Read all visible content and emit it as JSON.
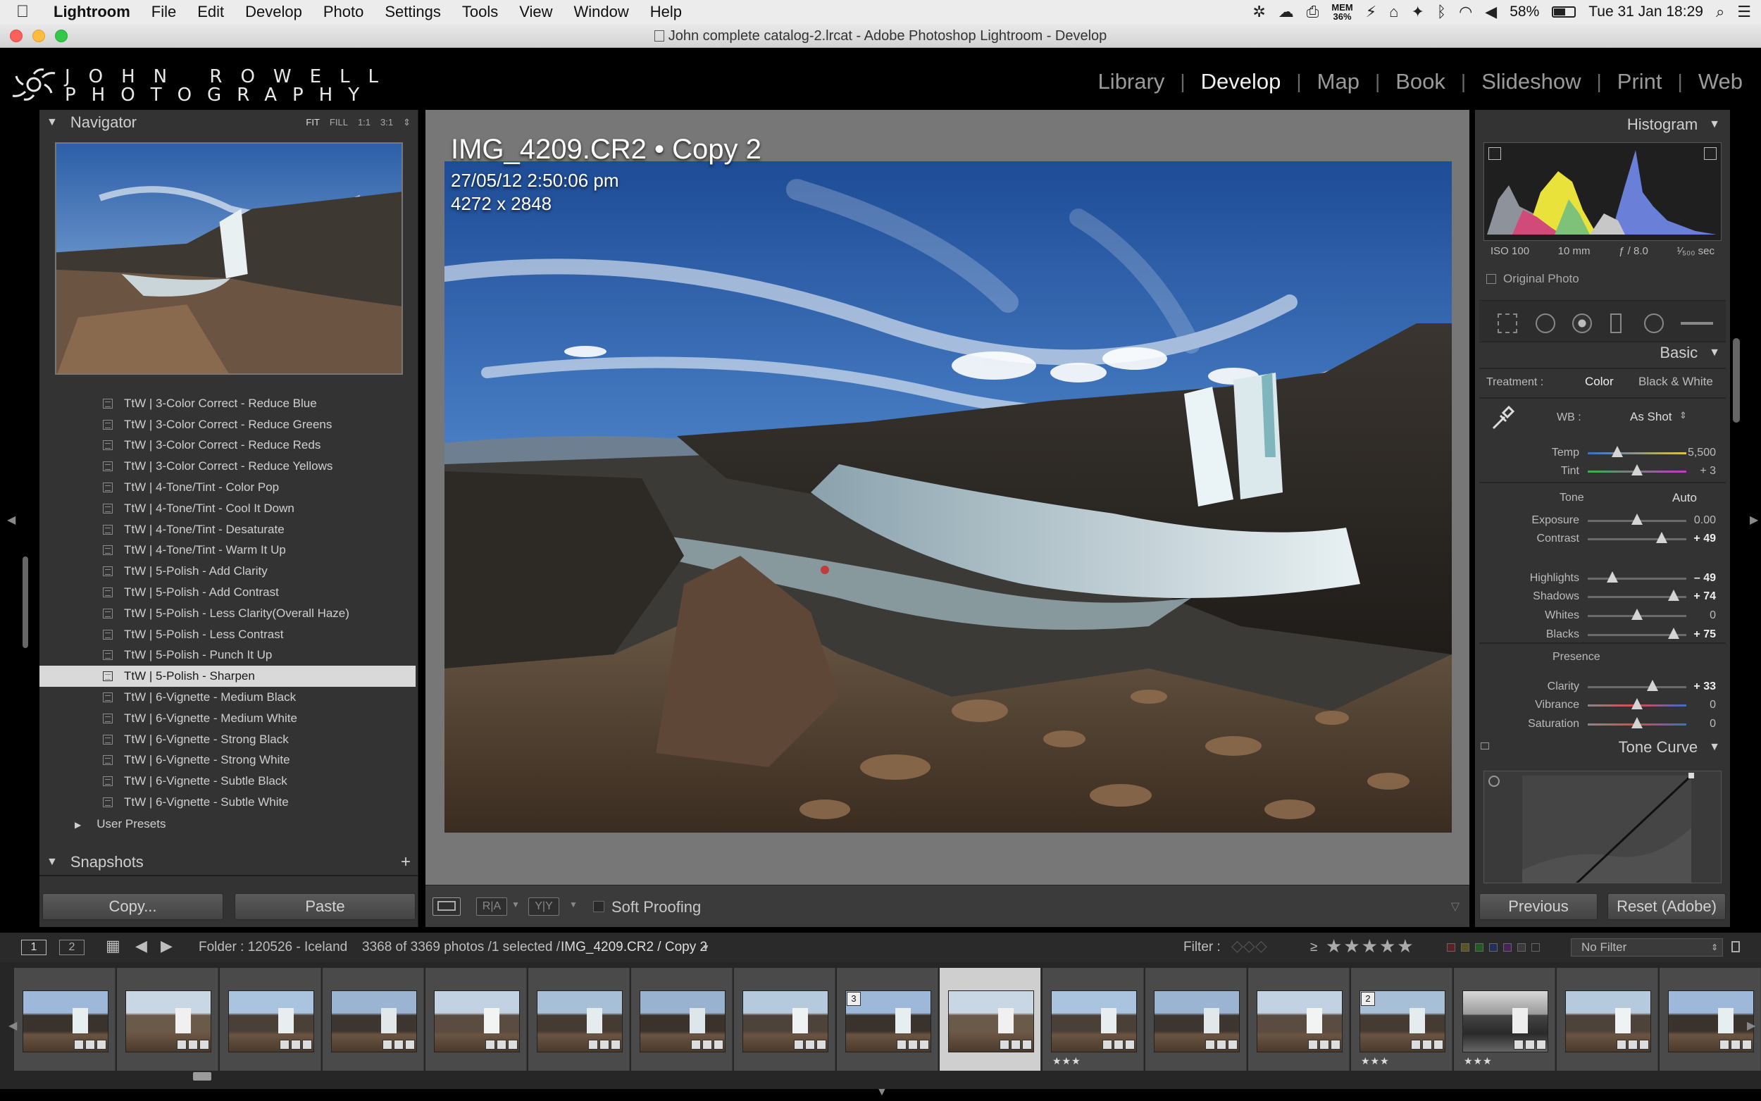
{
  "menubar": {
    "app": "Lightroom",
    "items": [
      "File",
      "Edit",
      "Develop",
      "Photo",
      "Settings",
      "Tools",
      "View",
      "Window",
      "Help"
    ],
    "memory": "MEM",
    "memory_pct": "36%",
    "battery": "58%",
    "clock": "Tue 31 Jan  18:29"
  },
  "window": {
    "title": "John complete catalog-2.lrcat - Adobe Photoshop Lightroom - Develop"
  },
  "identity": {
    "line1": "JOHN ROWELL",
    "line2": "PHOTOGRAPHY"
  },
  "modules": [
    "Library",
    "Develop",
    "Map",
    "Book",
    "Slideshow",
    "Print",
    "Web"
  ],
  "active_module": "Develop",
  "navigator": {
    "title": "Navigator",
    "opts": [
      "FIT",
      "FILL",
      "1:1",
      "3:1"
    ]
  },
  "presets": [
    "TtW | 3-Color Correct - Reduce Blue",
    "TtW | 3-Color Correct - Reduce Greens",
    "TtW | 3-Color Correct - Reduce Reds",
    "TtW | 3-Color Correct - Reduce Yellows",
    "TtW | 4-Tone/Tint - Color Pop",
    "TtW | 4-Tone/Tint - Cool It Down",
    "TtW | 4-Tone/Tint - Desaturate",
    "TtW | 4-Tone/Tint - Warm It Up",
    "TtW | 5-Polish - Add Clarity",
    "TtW | 5-Polish - Add Contrast",
    "TtW | 5-Polish - Less Clarity(Overall Haze)",
    "TtW | 5-Polish - Less Contrast",
    "TtW | 5-Polish - Punch It Up",
    "TtW | 5-Polish - Sharpen",
    "TtW | 6-Vignette - Medium Black",
    "TtW | 6-Vignette - Medium White",
    "TtW | 6-Vignette - Strong Black",
    "TtW | 6-Vignette - Strong White",
    "TtW | 6-Vignette - Subtle Black",
    "TtW | 6-Vignette - Subtle White"
  ],
  "selected_preset": "TtW | 5-Polish - Sharpen",
  "user_presets": "User Presets",
  "snapshots": {
    "title": "Snapshots",
    "add": "+"
  },
  "left_buttons": {
    "copy": "Copy...",
    "paste": "Paste"
  },
  "image_info": {
    "filename": "IMG_4209.CR2  •  Copy 2",
    "datetime": "27/05/12 2:50:06 pm",
    "dimensions": "4272 x 2848"
  },
  "toolbar": {
    "view_mode_1": "R|A",
    "view_mode_2": "Y|Y",
    "soft_proofing": "Soft Proofing"
  },
  "histogram": {
    "title": "Histogram",
    "iso": "ISO 100",
    "focal": "10 mm",
    "aperture": "ƒ / 8.0",
    "shutter": "¹⁄₅₀₀ sec",
    "original_photo": "Original Photo"
  },
  "basic": {
    "title": "Basic",
    "treatment_label": "Treatment :",
    "treatment_color": "Color",
    "treatment_bw": "Black & White",
    "wb_label": "WB :",
    "wb_value": "As Shot",
    "tone_label": "Tone",
    "auto": "Auto",
    "presence_label": "Presence",
    "sliders": [
      {
        "name": "Temp",
        "value": "5,500",
        "pos": 0.3,
        "bold": false
      },
      {
        "name": "Tint",
        "value": "+ 3",
        "pos": 0.5,
        "bold": false
      },
      {
        "name": "Exposure",
        "value": "0.00",
        "pos": 0.5,
        "bold": false
      },
      {
        "name": "Contrast",
        "value": "+ 49",
        "pos": 0.75,
        "bold": true
      },
      {
        "name": "Highlights",
        "value": "– 49",
        "pos": 0.25,
        "bold": true
      },
      {
        "name": "Shadows",
        "value": "+ 74",
        "pos": 0.87,
        "bold": true
      },
      {
        "name": "Whites",
        "value": "0",
        "pos": 0.5,
        "bold": false
      },
      {
        "name": "Blacks",
        "value": "+ 75",
        "pos": 0.87,
        "bold": true
      },
      {
        "name": "Clarity",
        "value": "+ 33",
        "pos": 0.66,
        "bold": true
      },
      {
        "name": "Vibrance",
        "value": "0",
        "pos": 0.5,
        "bold": false
      },
      {
        "name": "Saturation",
        "value": "0",
        "pos": 0.5,
        "bold": false
      }
    ]
  },
  "tone_curve": {
    "title": "Tone Curve"
  },
  "right_buttons": {
    "previous": "Previous",
    "reset": "Reset (Adobe)"
  },
  "filmstrip_bar": {
    "page1": "1",
    "page2": "2",
    "folder": "Folder : 120526 - Iceland",
    "count": "3368 of 3369 photos /1 selected /",
    "current": "IMG_4209.CR2 / Copy 2",
    "filter_label": "Filter :",
    "gte": "≥",
    "no_filter": "No Filter"
  },
  "filmstrip": [
    {
      "count": "",
      "stars": "",
      "selected": false,
      "bw": false
    },
    {
      "count": "",
      "stars": "",
      "selected": false,
      "bw": false
    },
    {
      "count": "",
      "stars": "",
      "selected": false,
      "bw": false
    },
    {
      "count": "",
      "stars": "",
      "selected": false,
      "bw": false
    },
    {
      "count": "",
      "stars": "",
      "selected": false,
      "bw": false
    },
    {
      "count": "",
      "stars": "",
      "selected": false,
      "bw": false
    },
    {
      "count": "",
      "stars": "",
      "selected": false,
      "bw": false
    },
    {
      "count": "",
      "stars": "",
      "selected": false,
      "bw": false
    },
    {
      "count": "3",
      "stars": "",
      "selected": false,
      "bw": false
    },
    {
      "count": "",
      "stars": "",
      "selected": true,
      "bw": false
    },
    {
      "count": "",
      "stars": "★★★",
      "selected": false,
      "bw": false
    },
    {
      "count": "",
      "stars": "",
      "selected": false,
      "bw": false
    },
    {
      "count": "",
      "stars": "",
      "selected": false,
      "bw": false
    },
    {
      "count": "2",
      "stars": "★★★",
      "selected": false,
      "bw": false
    },
    {
      "count": "",
      "stars": "★★★",
      "selected": false,
      "bw": true
    },
    {
      "count": "",
      "stars": "",
      "selected": false,
      "bw": false
    },
    {
      "count": "",
      "stars": "",
      "selected": false,
      "bw": false
    }
  ]
}
